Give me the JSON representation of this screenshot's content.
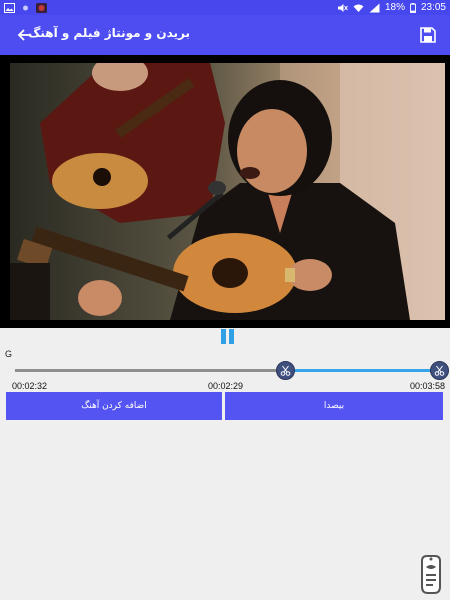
{
  "status_bar": {
    "battery": "18%",
    "time": "23:05",
    "icons": [
      "gallery-icon",
      "notification-dot-icon",
      "app-icon",
      "mute-icon",
      "wifi-icon",
      "signal-icon",
      "battery-icon"
    ]
  },
  "toolbar": {
    "title": "بریدن و مونتاژ فیلم و آهنگ",
    "back_icon": "arrow-back-icon",
    "save_icon": "save-icon"
  },
  "video": {
    "state": "playing"
  },
  "player": {
    "pause_icon": "pause-icon",
    "track_label": "G",
    "start_time": "00:02:32",
    "current_time": "00:02:29",
    "end_time": "00:03:58",
    "selection_start_fraction": 0.64,
    "selection_end_fraction": 1.0
  },
  "actions": {
    "add_music_label": "اضافه کردن آهنگ",
    "share_label": "بیصدا"
  },
  "colors": {
    "status_bar": "#4747ee",
    "toolbar": "#4d4df2",
    "button": "#5454f3",
    "accent_blue": "#35a4ea",
    "track_grey": "#8e8e8e",
    "handle": "#3f4f7e",
    "background": "#efefef"
  }
}
